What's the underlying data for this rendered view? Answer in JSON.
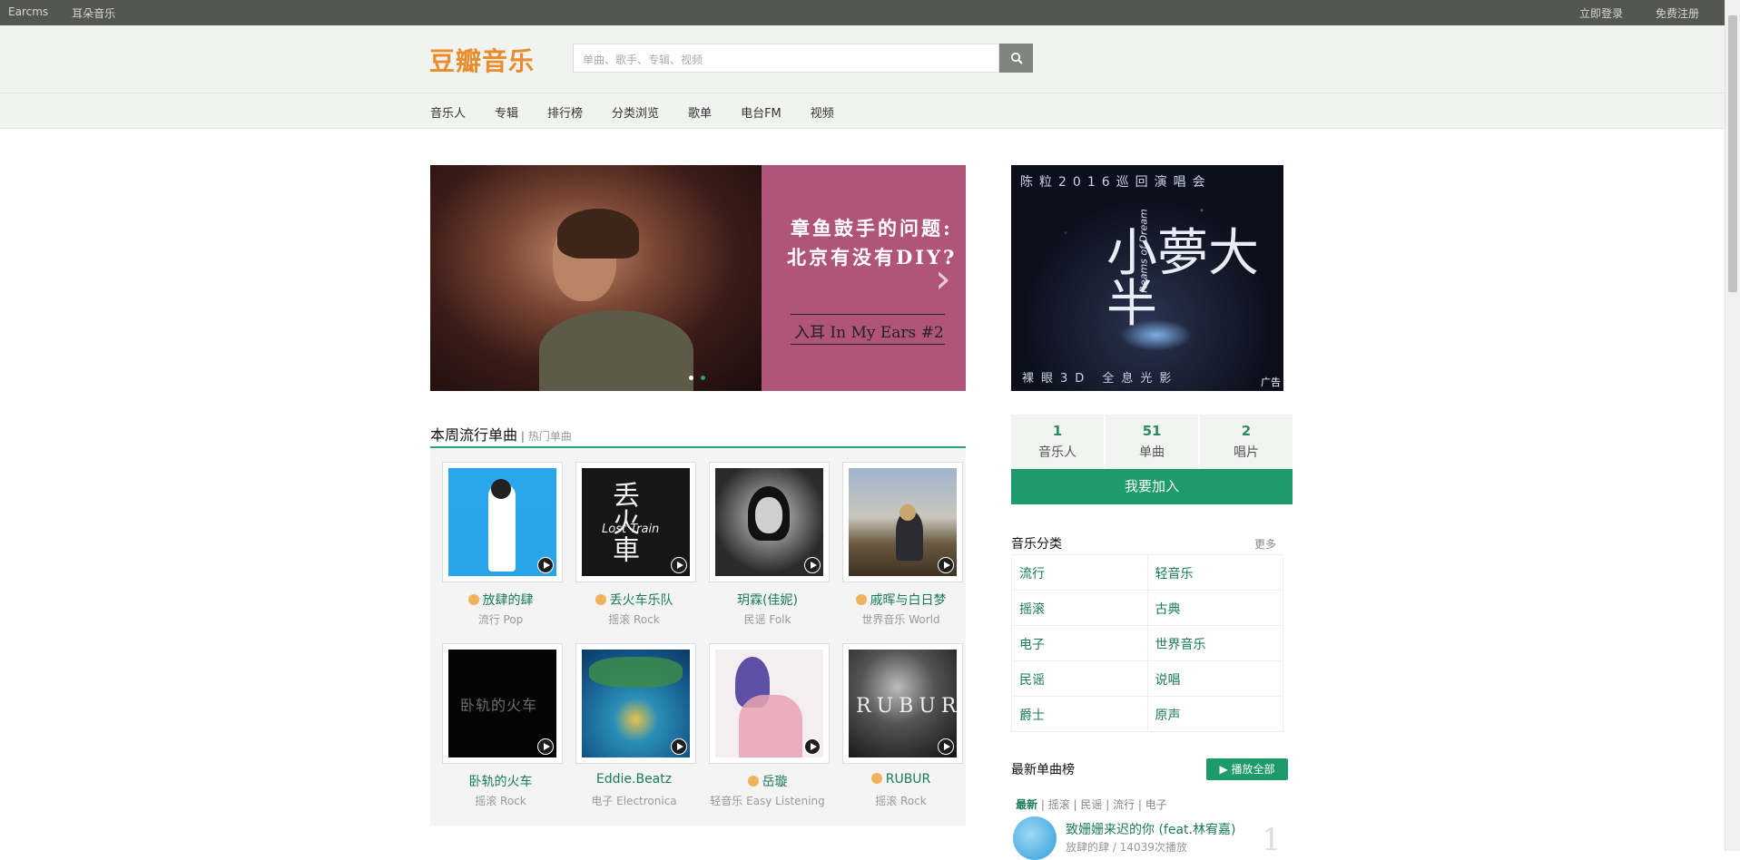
{
  "topbar": {
    "left": [
      "Earcms",
      "耳朵音乐"
    ],
    "right": [
      "立即登录",
      "免费注册"
    ]
  },
  "header": {
    "logo": "豆瓣音乐",
    "search_placeholder": "单曲、歌手、专辑、视频"
  },
  "nav": [
    "音乐人",
    "专辑",
    "排行榜",
    "分类浏览",
    "歌单",
    "电台FM",
    "视频"
  ],
  "banner": {
    "line1": "章鱼鼓手的问题:",
    "line2": "北京有没有DIY?",
    "line3": "入耳 In My Ears #2"
  },
  "ad": {
    "top_text": "陈粒2016巡回演唱会",
    "title_text": "小夢大半",
    "sub_text": "Reams of Dream",
    "bottom_text": "裸眼3D 全息光影",
    "tag": "广告"
  },
  "stats": [
    {
      "num": "1",
      "label": "音乐人"
    },
    {
      "num": "51",
      "label": "单曲"
    },
    {
      "num": "2",
      "label": "唱片"
    }
  ],
  "join_label": "我要加入",
  "singles": {
    "title": "本周流行单曲",
    "sep": "|",
    "alt": "热门单曲",
    "items": [
      {
        "name": "放肆的肆",
        "genre": "流行 Pop",
        "icon": true
      },
      {
        "name": "丢火车乐队",
        "genre": "摇滚 Rock",
        "icon": true
      },
      {
        "name": "玥霖(佳妮)",
        "genre": "民谣 Folk",
        "icon": false
      },
      {
        "name": "戚晖与白日梦",
        "genre": "世界音乐 World",
        "icon": true
      },
      {
        "name": "卧轨的火车",
        "genre": "摇滚 Rock",
        "icon": false
      },
      {
        "name": "Eddie.Beatz",
        "genre": "电子 Electronica",
        "icon": false
      },
      {
        "name": "岳璇",
        "genre": "轻音乐 Easy Listening",
        "icon": true
      },
      {
        "name": "RUBUR",
        "genre": "摇滚 Rock",
        "icon": true
      }
    ],
    "art_text": {
      "train": "丢火車",
      "train_en": "Lost Train",
      "rail": "卧轨的火车",
      "rubur": "RUBUR"
    }
  },
  "genres": {
    "title": "音乐分类",
    "more": "更多",
    "rows": [
      [
        "流行",
        "轻音乐"
      ],
      [
        "摇滚",
        "古典"
      ],
      [
        "电子",
        "世界音乐"
      ],
      [
        "民谣",
        "说唱"
      ],
      [
        "爵士",
        "原声"
      ]
    ]
  },
  "latest": {
    "title": "最新单曲榜",
    "play_all": "播放全部",
    "tabs": [
      "最新",
      "摇滚",
      "民谣",
      "流行",
      "电子"
    ],
    "song_title": "致姗姗来迟的你 (feat.林宥嘉)",
    "song_sub": "放肆的肆 / 14039次播放",
    "rank": "1"
  },
  "colors": {
    "brand": "#e98d2c",
    "accent": "#1d9b6c",
    "topbar": "#545652"
  }
}
